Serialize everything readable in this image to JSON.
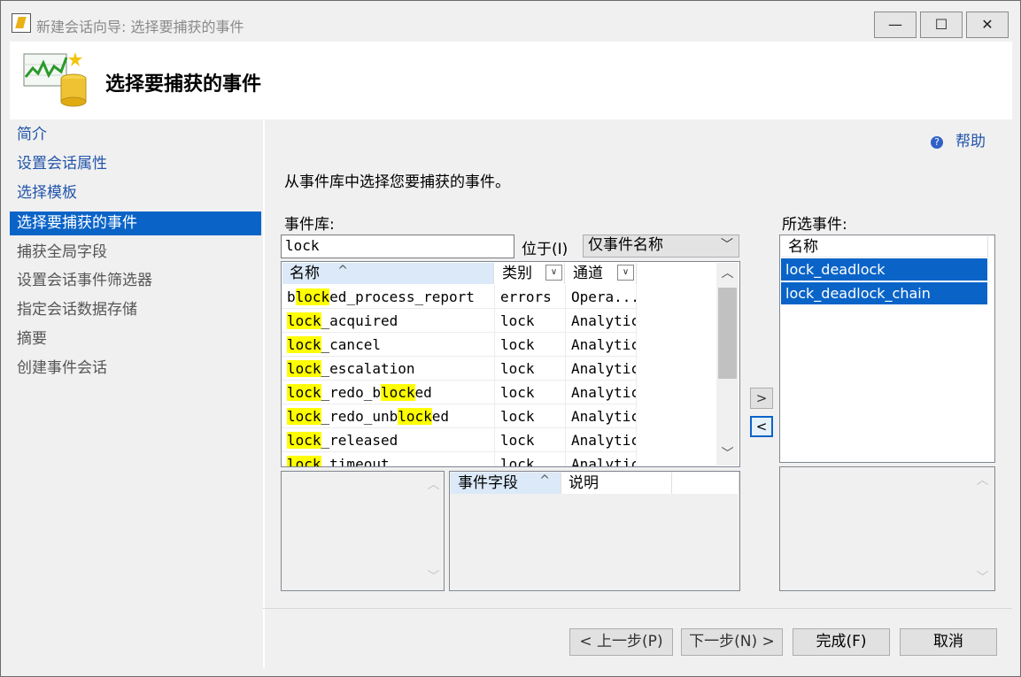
{
  "window": {
    "title": "新建会话向导: 选择要捕获的事件",
    "controls": {
      "minimize": "—",
      "maximize": "☐",
      "close": "✕"
    }
  },
  "header": {
    "title": "选择要捕获的事件",
    "icon": "chart-database-icon"
  },
  "nav": {
    "items": [
      {
        "label": "简介",
        "state": "link"
      },
      {
        "label": "设置会话属性",
        "state": "link"
      },
      {
        "label": "选择模板",
        "state": "link"
      },
      {
        "label": "选择要捕获的事件",
        "state": "active"
      },
      {
        "label": "捕获全局字段",
        "state": "dim"
      },
      {
        "label": "设置会话事件筛选器",
        "state": "dim"
      },
      {
        "label": "指定会话数据存储",
        "state": "dim"
      },
      {
        "label": "摘要",
        "state": "dim"
      },
      {
        "label": "创建事件会话",
        "state": "dim"
      }
    ]
  },
  "help": {
    "label": "帮助",
    "icon": "?"
  },
  "instruction": "从事件库中选择您要捕获的事件。",
  "library": {
    "label": "事件库:",
    "search_value": "lock",
    "in_label": "位于(I)",
    "scope_value": "仅事件名称",
    "columns": {
      "name": "名称",
      "category": "类别",
      "channel": "通道"
    },
    "rows": [
      {
        "name_parts": [
          [
            "b",
            0
          ],
          [
            "lock",
            1
          ],
          [
            "ed_process_report",
            0
          ]
        ],
        "category": "errors",
        "channel": "Opera..."
      },
      {
        "name_parts": [
          [
            "lock",
            1
          ],
          [
            "_acquired",
            0
          ]
        ],
        "category": "lock",
        "channel": "Analytic"
      },
      {
        "name_parts": [
          [
            "lock",
            1
          ],
          [
            "_cancel",
            0
          ]
        ],
        "category": "lock",
        "channel": "Analytic"
      },
      {
        "name_parts": [
          [
            "lock",
            1
          ],
          [
            "_escalation",
            0
          ]
        ],
        "category": "lock",
        "channel": "Analytic"
      },
      {
        "name_parts": [
          [
            "lock",
            1
          ],
          [
            "_redo_b",
            0
          ],
          [
            "lock",
            1
          ],
          [
            "ed",
            0
          ]
        ],
        "category": "lock",
        "channel": "Analytic"
      },
      {
        "name_parts": [
          [
            "lock",
            1
          ],
          [
            "_redo_unb",
            0
          ],
          [
            "lock",
            1
          ],
          [
            "ed",
            0
          ]
        ],
        "category": "lock",
        "channel": "Analytic"
      },
      {
        "name_parts": [
          [
            "lock",
            1
          ],
          [
            "_released",
            0
          ]
        ],
        "category": "lock",
        "channel": "Analytic"
      },
      {
        "name_parts": [
          [
            "lock",
            1
          ],
          [
            "_timeout",
            0
          ]
        ],
        "category": "lock",
        "channel": "Analytic"
      }
    ]
  },
  "fields_grid": {
    "col_field": "事件字段",
    "col_desc": "说明"
  },
  "selected": {
    "label": "所选事件:",
    "column": "名称",
    "items": [
      "lock_deadlock",
      "lock_deadlock_chain"
    ]
  },
  "move": {
    "add": ">",
    "remove": "<"
  },
  "buttons": {
    "back": "< 上一步(P)",
    "next": "下一步(N) >",
    "finish": "完成(F)",
    "cancel": "取消"
  },
  "colors": {
    "accent": "#0a64c8",
    "highlight": "#ffff00",
    "link": "#2255aa"
  }
}
